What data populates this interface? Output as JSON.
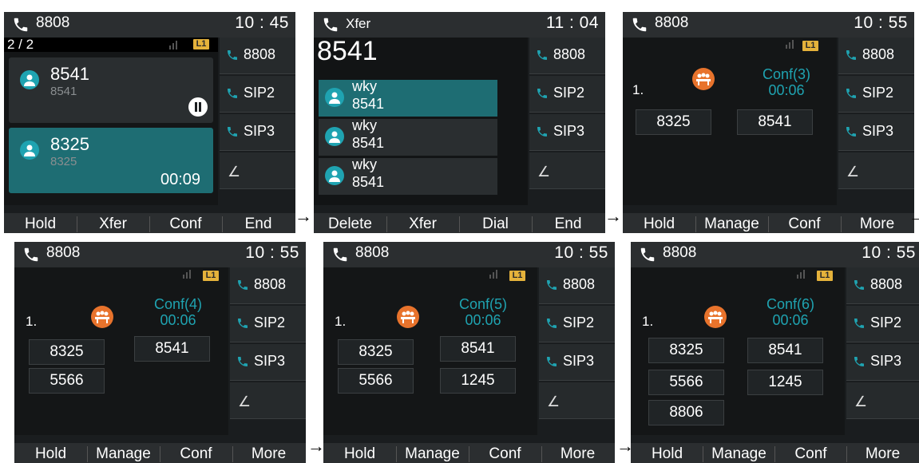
{
  "colors": {
    "accent": "#1fa3b1",
    "active_card": "#1e6d73",
    "conf_icon": "#e8732c",
    "line_badge": "#e5b23b",
    "background": "#1a1d1f"
  },
  "arrow": "→",
  "badge": "L1",
  "screens": [
    {
      "title": "8808",
      "time": "10 : 45",
      "call_count": "2 / 2",
      "calls": [
        {
          "name": "8541",
          "number": "8541",
          "state": "paused",
          "active": false
        },
        {
          "name": "8325",
          "number": "8325",
          "timer": "00:09",
          "active": true
        }
      ],
      "lines": [
        "8808",
        "SIP2",
        "SIP3"
      ],
      "softkeys": [
        "Hold",
        "Xfer",
        "Conf",
        "End"
      ]
    },
    {
      "title": "Xfer",
      "time": "11 : 04",
      "dial_number": "8541",
      "contacts": [
        {
          "name": "wky",
          "number": "8541"
        },
        {
          "name": "wky",
          "number": "8541"
        },
        {
          "name": "wky",
          "number": "8541"
        }
      ],
      "lines": [
        "8808",
        "SIP2",
        "SIP3"
      ],
      "softkeys": [
        "Delete",
        "Xfer",
        "Dial",
        "End"
      ]
    },
    {
      "title": "8808",
      "time": "10 : 55",
      "index": "1.",
      "conf_label": "Conf(3)",
      "conf_time": "00:06",
      "participants": [
        "8325",
        "8541"
      ],
      "lines": [
        "8808",
        "SIP2",
        "SIP3"
      ],
      "softkeys": [
        "Hold",
        "Manage",
        "Conf",
        "More"
      ]
    },
    {
      "title": "8808",
      "time": "10 : 55",
      "index": "1.",
      "conf_label": "Conf(4)",
      "conf_time": "00:06",
      "participants": [
        "8325",
        "8541",
        "5566"
      ],
      "lines": [
        "8808",
        "SIP2",
        "SIP3"
      ],
      "softkeys": [
        "Hold",
        "Manage",
        "Conf",
        "More"
      ]
    },
    {
      "title": "8808",
      "time": "10 : 55",
      "index": "1.",
      "conf_label": "Conf(5)",
      "conf_time": "00:06",
      "participants": [
        "8325",
        "8541",
        "5566",
        "1245"
      ],
      "lines": [
        "8808",
        "SIP2",
        "SIP3"
      ],
      "softkeys": [
        "Hold",
        "Manage",
        "Conf",
        "More"
      ]
    },
    {
      "title": "8808",
      "time": "10 : 55",
      "index": "1.",
      "conf_label": "Conf(6)",
      "conf_time": "00:06",
      "participants": [
        "8325",
        "8541",
        "5566",
        "1245",
        "8806"
      ],
      "lines": [
        "8808",
        "SIP2",
        "SIP3"
      ],
      "softkeys": [
        "Hold",
        "Manage",
        "Conf",
        "More"
      ]
    }
  ]
}
